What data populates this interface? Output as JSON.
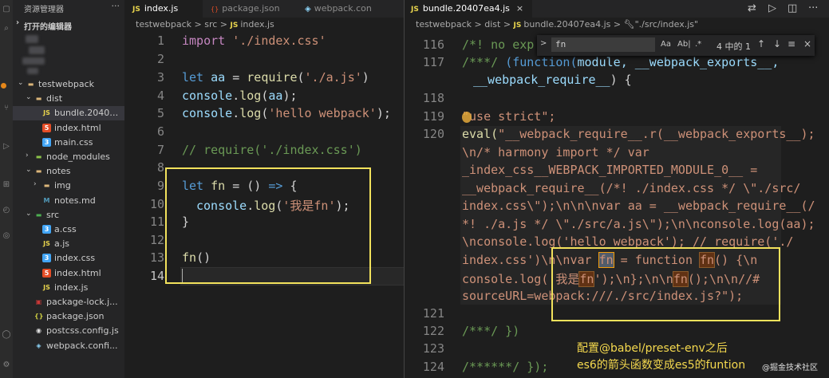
{
  "explorer": {
    "title": "资源管理器",
    "open_editors": "打开的编辑器",
    "tree": [
      {
        "label": "testwebpack",
        "type": "folder",
        "open": true,
        "depth": 1
      },
      {
        "label": "dist",
        "type": "folder",
        "open": true,
        "depth": 2
      },
      {
        "label": "bundle.20407...",
        "type": "js",
        "depth": 3,
        "selected": true
      },
      {
        "label": "index.html",
        "type": "html",
        "depth": 3
      },
      {
        "label": "main.css",
        "type": "css",
        "depth": 3
      },
      {
        "label": "node_modules",
        "type": "nm",
        "open": false,
        "depth": 2
      },
      {
        "label": "notes",
        "type": "folder",
        "open": true,
        "depth": 2
      },
      {
        "label": "img",
        "type": "folder",
        "open": false,
        "depth": 3
      },
      {
        "label": "notes.md",
        "type": "md",
        "depth": 3
      },
      {
        "label": "src",
        "type": "src",
        "open": true,
        "depth": 2
      },
      {
        "label": "a.css",
        "type": "css",
        "depth": 3
      },
      {
        "label": "a.js",
        "type": "js",
        "depth": 3
      },
      {
        "label": "index.css",
        "type": "css",
        "depth": 3
      },
      {
        "label": "index.html",
        "type": "html",
        "depth": 3
      },
      {
        "label": "index.js",
        "type": "js",
        "depth": 3
      },
      {
        "label": "package-lock.j...",
        "type": "lock",
        "depth": 2
      },
      {
        "label": "package.json",
        "type": "json",
        "depth": 2
      },
      {
        "label": "postcss.config.js",
        "type": "cfg",
        "depth": 2
      },
      {
        "label": "webpack.confi...",
        "type": "wp",
        "depth": 2
      }
    ]
  },
  "left_editor": {
    "tabs": [
      {
        "badge": "JS",
        "label": "index.js",
        "active": true
      },
      {
        "badge": "{}",
        "label": "package.json",
        "active": false
      },
      {
        "badge": "◈",
        "label": "webpack.con",
        "active": false
      }
    ],
    "breadcrumb": {
      "root": "testwebpack",
      "sep": ">",
      "folder": "src",
      "badge": "JS",
      "file": "index.js"
    },
    "line_numbers": [
      "1",
      "2",
      "3",
      "4",
      "5",
      "6",
      "7",
      "8",
      "9",
      "10",
      "11",
      "12",
      "13",
      "14"
    ],
    "current_line": "14",
    "lines": {
      "l1_kw": "import",
      "l1_str": "'./index.css'",
      "l3_kw": "let",
      "l3_var": "aa",
      "l3_eq": " = ",
      "l3_fn": "require",
      "l3_p1": "(",
      "l3_str": "'./a.js'",
      "l3_p2": ")",
      "l4_var": "console",
      "l4_dot": ".",
      "l4_fn": "log",
      "l4_p1": "(",
      "l4_arg": "aa",
      "l4_p2": ");",
      "l5_var": "console",
      "l5_dot": ".",
      "l5_fn": "log",
      "l5_p1": "(",
      "l5_str": "'hello webpack'",
      "l5_p2": ");",
      "l7_cmt": "// require('./index.css')",
      "l9_kw": "let",
      "l9_fn": "fn",
      "l9_eq": " = () ",
      "l9_arrow": "=>",
      "l9_br": " {",
      "l10_var": "console",
      "l10_dot": ".",
      "l10_fn": "log",
      "l10_p1": "(",
      "l10_str": "'我是fn'",
      "l10_p2": ");",
      "l11": "}",
      "l13_fn": "fn",
      "l13_p": "()"
    }
  },
  "right_editor": {
    "tab": {
      "badge": "JS",
      "label": "bundle.20407ea4.js",
      "close": "×"
    },
    "breadcrumb": {
      "root": "testwebpack",
      "sep": ">",
      "folder": "dist",
      "badge": "JS",
      "file": "bundle.20407ea4.js",
      "symbol": "\"./src/index.js\""
    },
    "line_numbers": {
      "n116": "116",
      "n117": "117",
      "n118": "118",
      "n119": "119",
      "n120": "120",
      "n121": "121",
      "n122": "122",
      "n123": "123",
      "n124": "124"
    },
    "lines": {
      "l116": "/*! no exp",
      "l117a": "/***/ ",
      "l117b": "(function(",
      "l117c": "module",
      ", ": "",
      "l117d": ", __webpack_exports__,",
      "l117e": "__webpack_require__",
      "l117f": ") {",
      "l119a": "\"use strict\";",
      "l120a": "eval(",
      "l120_1": "\"__webpack_require__.r(__webpack_exports__);",
      "l120_2": "\\n/* harmony import */ var",
      "l120_3": "_index_css__WEBPACK_IMPORTED_MODULE_0__ =",
      "l120_4": "__webpack_require__(/*! ./index.css */ \\\"./src/",
      "l120_5": "index.css\\\");\\n\\n\\nvar aa = __webpack_require__(/",
      "l120_6": "*! ./a.js */ \\\"./src/a.js\\\");\\n\\nconsole.log(aa);",
      "l120_7": "\\nconsole.log('hello webpack'); // require('./",
      "l120_8a": "index.css')\\n\\nvar ",
      "l120_8b": "fn",
      "l120_8c": " = function ",
      "l120_8d": "fn",
      "l120_8e": "() {\\n",
      "l120_9a": "console.log('我是",
      "l120_9b": "fn",
      "l120_9c": "');\\n};\\n\\n",
      "l120_9d": "fn",
      "l120_9e": "();\\n\\n//#",
      "l120_10": "sourceURL=webpack:///./src/index.js?\");",
      "l122": "/***/ })",
      "l124": "/******/ });"
    }
  },
  "find_widget": {
    "query": "fn",
    "match_case": "Aa",
    "whole_word": "Ab|",
    "regex": ".*",
    "count": "4 中的 1",
    "prev": "↑",
    "next": "↓",
    "in_selection": "≡",
    "close": "×",
    "toggle": ">"
  },
  "annotation": {
    "line1": "配置@babel/preset-env之后",
    "line2": "es6的箭头函数变成es5的funtion"
  },
  "watermark": "@掘金技术社区",
  "colors": {
    "highlight_box": "#f2e25c",
    "annotation_text": "#f5d94e",
    "find_match": "#613214"
  }
}
